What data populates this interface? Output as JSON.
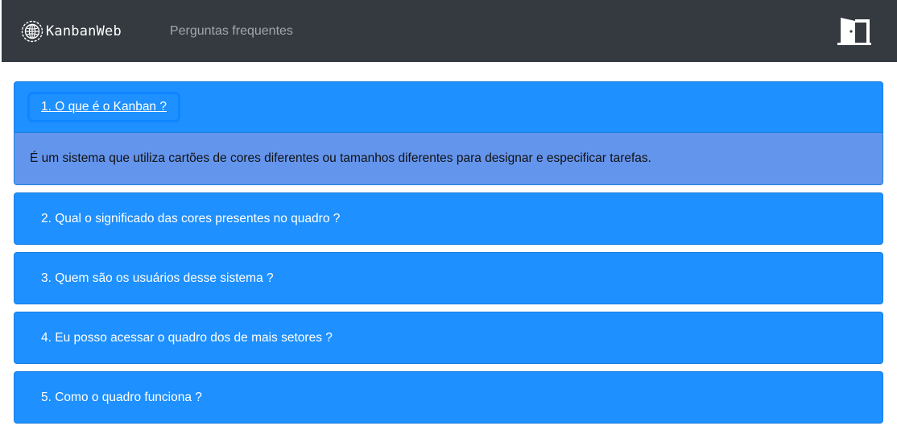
{
  "navbar": {
    "brand": "KanbanWeb",
    "link": "Perguntas frequentes",
    "exit_icon": "door-exit-icon"
  },
  "colors": {
    "navbar_bg": "#343a40",
    "card_header": "#1e90ff",
    "card_body": "#6495ed"
  },
  "faq": [
    {
      "question": "1. O que é o Kanban ?",
      "answer": "É um sistema que utiliza cartões de cores diferentes ou tamanhos diferentes para designar e especificar tarefas.",
      "expanded": true
    },
    {
      "question": "2. Qual o significado das cores presentes no quadro ?",
      "expanded": false
    },
    {
      "question": "3. Quem são os usuários desse sistema ?",
      "expanded": false
    },
    {
      "question": "4. Eu posso acessar o quadro dos de mais setores ?",
      "expanded": false
    },
    {
      "question": "5. Como o quadro funciona ?",
      "expanded": false
    }
  ]
}
